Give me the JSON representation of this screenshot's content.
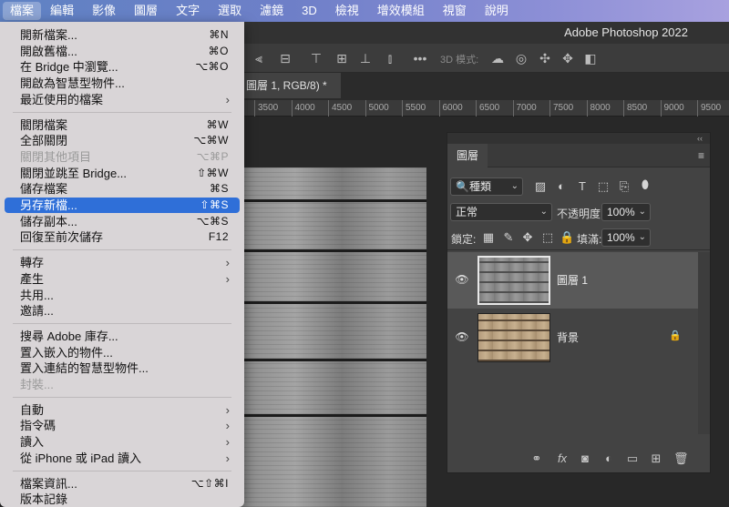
{
  "menubar": {
    "items": [
      "檔案",
      "編輯",
      "影像",
      "圖層",
      "文字",
      "選取",
      "濾鏡",
      "3D",
      "檢視",
      "增效模組",
      "視窗",
      "說明"
    ],
    "active_index": 0
  },
  "app": {
    "title": "Adobe Photoshop 2022",
    "options_bar": {
      "mode_3d_label": "3D 模式:"
    },
    "document_tab": "圖層 1, RGB/8) *",
    "ruler_ticks": [
      "3500",
      "4000",
      "4500",
      "5000",
      "5500",
      "6000",
      "6500",
      "7000",
      "7500",
      "8000",
      "8500",
      "9000",
      "9500"
    ]
  },
  "file_menu": {
    "items": [
      {
        "label": "開新檔案...",
        "shortcut": "⌘N"
      },
      {
        "label": "開啟舊檔...",
        "shortcut": "⌘O"
      },
      {
        "label": "在 Bridge 中瀏覽...",
        "shortcut": "⌥⌘O"
      },
      {
        "label": "開啟為智慧型物件...",
        "shortcut": ""
      },
      {
        "label": "最近使用的檔案",
        "shortcut": "",
        "submenu": true
      },
      {
        "separator": true
      },
      {
        "label": "關閉檔案",
        "shortcut": "⌘W"
      },
      {
        "label": "全部關閉",
        "shortcut": "⌥⌘W"
      },
      {
        "label": "關閉其他項目",
        "shortcut": "⌥⌘P",
        "disabled": true
      },
      {
        "label": "關閉並跳至 Bridge...",
        "shortcut": "⇧⌘W"
      },
      {
        "label": "儲存檔案",
        "shortcut": "⌘S"
      },
      {
        "label": "另存新檔...",
        "shortcut": "⇧⌘S",
        "highlighted": true
      },
      {
        "label": "儲存副本...",
        "shortcut": "⌥⌘S"
      },
      {
        "label": "回復至前次儲存",
        "shortcut": "F12"
      },
      {
        "separator": true
      },
      {
        "label": "轉存",
        "shortcut": "",
        "submenu": true
      },
      {
        "label": "產生",
        "shortcut": "",
        "submenu": true
      },
      {
        "label": "共用...",
        "shortcut": ""
      },
      {
        "label": "邀請...",
        "shortcut": ""
      },
      {
        "separator": true
      },
      {
        "label": "搜尋 Adobe 庫存...",
        "shortcut": ""
      },
      {
        "label": "置入嵌入的物件...",
        "shortcut": ""
      },
      {
        "label": "置入連結的智慧型物件...",
        "shortcut": ""
      },
      {
        "label": "封裝...",
        "shortcut": "",
        "disabled": true
      },
      {
        "separator": true
      },
      {
        "label": "自動",
        "shortcut": "",
        "submenu": true
      },
      {
        "label": "指令碼",
        "shortcut": "",
        "submenu": true
      },
      {
        "label": "讀入",
        "shortcut": "",
        "submenu": true
      },
      {
        "label": "從 iPhone 或 iPad 讀入",
        "shortcut": "",
        "submenu": true
      },
      {
        "separator": true
      },
      {
        "label": "檔案資訊...",
        "shortcut": "⌥⇧⌘I"
      },
      {
        "label": "版本記錄",
        "shortcut": ""
      }
    ]
  },
  "layers_panel": {
    "collapse_glyph": "‹‹",
    "tab_label": "圖層",
    "filter_kind": "種類",
    "blend_mode": "正常",
    "opacity_label": "不透明度:",
    "opacity_value": "100%",
    "lock_label": "鎖定:",
    "fill_label": "填滿:",
    "fill_value": "100%",
    "layers": [
      {
        "name": "圖層 1",
        "selected": true,
        "visible": true,
        "locked": false
      },
      {
        "name": "背景",
        "selected": false,
        "visible": true,
        "locked": true
      }
    ],
    "footer_fx_label": "fx"
  },
  "colors": {
    "menu_highlight": "#2f6fd8",
    "menu_bg": "#d9d5d7",
    "panel_bg": "#434343",
    "selected_layer_bg": "#595959"
  }
}
